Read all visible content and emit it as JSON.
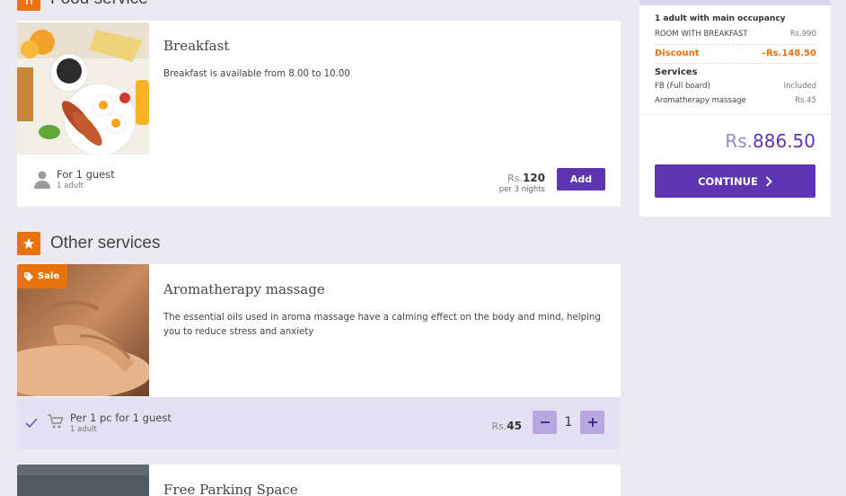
{
  "food_section": {
    "title": "Food service"
  },
  "breakfast": {
    "title": "Breakfast",
    "description": "Breakfast is available from 8.00 to 10.00",
    "guest_label": "For 1 guest",
    "guest_sub": "1 adult",
    "price_currency": "Rs.",
    "price_value": "120",
    "price_sub": "per 3 nights",
    "add_label": "Add"
  },
  "other_section": {
    "title": "Other services"
  },
  "massage": {
    "badge": "Sale",
    "title": "Aromatherapy massage",
    "description": "The essential oils used in aroma massage have a calming effect on the body and mind, helping you to reduce stress and anxiety",
    "guest_label": "Per 1 pc for 1 guest",
    "guest_sub": "1 adult",
    "price_currency": "Rs.",
    "price_value": "45",
    "quantity": "1"
  },
  "parking": {
    "title": "Free Parking Space"
  },
  "summary": {
    "occupancy": "1 adult with main occupancy",
    "room_label": "ROOM WITH BREAKFAST",
    "room_price": "Rs.990",
    "discount_label": "Discount",
    "discount_value": "–Rs.148.50",
    "services_label": "Services",
    "services": [
      {
        "label": "FB (Full board)",
        "value": "Included"
      },
      {
        "label": "Aromatherapy massage",
        "value": "Rs.45"
      }
    ],
    "total_currency": "Rs.",
    "total_value": "886.50",
    "continue_label": "CONTINUE"
  },
  "colors": {
    "accent": "#5e35b1",
    "orange": "#e8720c",
    "background": "#ebe9f1"
  }
}
